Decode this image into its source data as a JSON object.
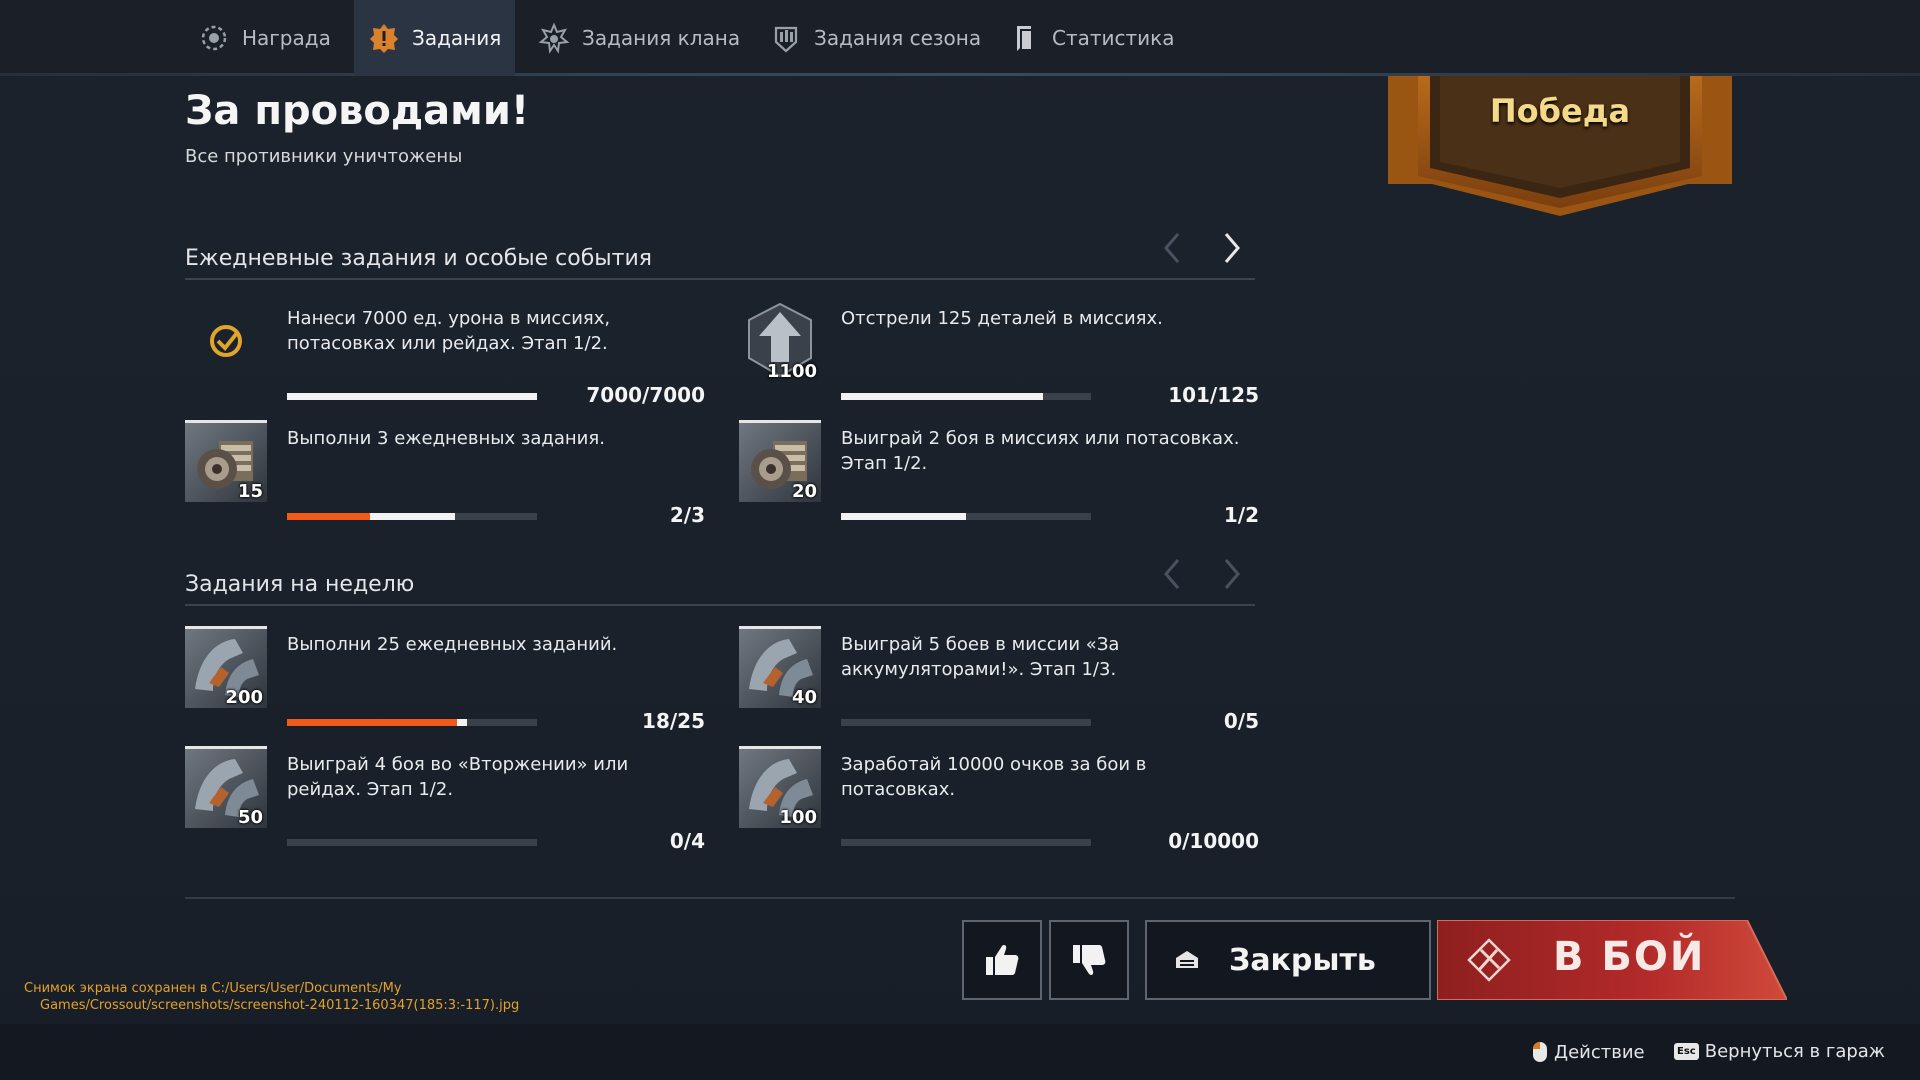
{
  "nav": {
    "tabs": [
      {
        "label": "Награда",
        "icon": "reward-icon"
      },
      {
        "label": "Задания",
        "icon": "missions-icon"
      },
      {
        "label": "Задания клана",
        "icon": "clan-missions-icon"
      },
      {
        "label": "Задания сезона",
        "icon": "season-missions-icon"
      },
      {
        "label": "Статистика",
        "icon": "statistics-icon"
      }
    ]
  },
  "header": {
    "title": "За проводами!",
    "subtitle": "Все противники уничтожены",
    "result_banner": "Победа"
  },
  "daily": {
    "title": "Ежедневные задания и особые события",
    "tasks": [
      {
        "desc": "Нанеси 7000 ед. урона в миссиях, потасовках или рейдах. Этап 1/2.",
        "progress_text": "7000/7000",
        "reward": "",
        "icon": "check-icon",
        "progress": 1.0
      },
      {
        "desc": "Отстрели 125 деталей в миссиях.",
        "progress_text": "101/125",
        "reward": "1100",
        "icon": "upgrade-arrow-icon",
        "progress": 0.808
      },
      {
        "desc": "Выполни 3 ежедневных задания.",
        "progress_text": "2/3",
        "reward": "15",
        "icon": "crate-icon",
        "progress": 0.667
      },
      {
        "desc": "Выиграй 2 боя в миссиях или потасовках. Этап 1/2.",
        "progress_text": "1/2",
        "reward": "20",
        "icon": "crate-icon",
        "progress": 0.5
      }
    ]
  },
  "weekly": {
    "title": "Задания на неделю",
    "tasks": [
      {
        "desc": "Выполни 25 ежедневных заданий.",
        "progress_text": "18/25",
        "reward": "200",
        "icon": "scrap-icon",
        "progress": 0.72
      },
      {
        "desc": "Выиграй 5 боев в миссии «За аккумуляторами!». Этап 1/3.",
        "progress_text": "0/5",
        "reward": "40",
        "icon": "scrap-icon",
        "progress": 0
      },
      {
        "desc": "Выиграй 4 боя во «Вторжении» или рейдах. Этап 1/2.",
        "progress_text": "0/4",
        "reward": "50",
        "icon": "scrap-icon",
        "progress": 0
      },
      {
        "desc": "Заработай 10000 очков за бои в потасовках.",
        "progress_text": "0/10000",
        "reward": "100",
        "icon": "scrap-icon",
        "progress": 0
      }
    ]
  },
  "actions": {
    "like_icon": "thumbs-up-icon",
    "dislike_icon": "thumbs-down-icon",
    "close_label": "Закрыть",
    "fight_label": "В БОЙ"
  },
  "notice": {
    "line1": "Снимок экрана сохранен в C:/Users/User/Documents/My",
    "line2": "Games/Crossout/screenshots/screenshot-240112-160347(185:3:-117).jpg"
  },
  "footer": {
    "action_label": "Действие",
    "esc_key": "Esc",
    "back_label": "Вернуться в гараж"
  },
  "colors": {
    "accent_orange": "#f25a1a",
    "fight_red": "#b02a2a",
    "banner_gold": "#f3d98a"
  }
}
